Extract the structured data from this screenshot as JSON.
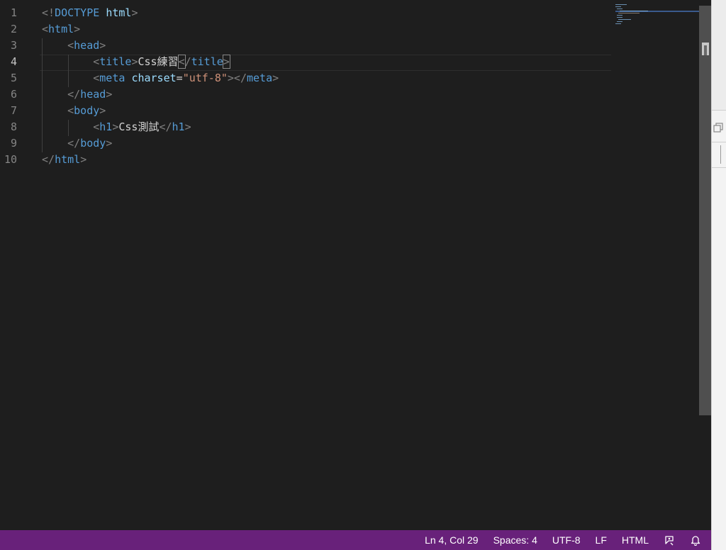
{
  "editor": {
    "lines": [
      {
        "num": "1",
        "indent": "",
        "tokens": [
          [
            "tag-brk",
            "<!"
          ],
          [
            "tag",
            "DOCTYPE"
          ],
          [
            "txt",
            " "
          ],
          [
            "attr",
            "html"
          ],
          [
            "tag-brk",
            ">"
          ]
        ]
      },
      {
        "num": "2",
        "indent": "",
        "tokens": [
          [
            "tag-brk",
            "<"
          ],
          [
            "tag",
            "html"
          ],
          [
            "tag-brk",
            ">"
          ]
        ]
      },
      {
        "num": "3",
        "indent": "    ",
        "tokens": [
          [
            "tag-brk",
            "<"
          ],
          [
            "tag",
            "head"
          ],
          [
            "tag-brk",
            ">"
          ]
        ]
      },
      {
        "num": "4",
        "indent": "        ",
        "tokens": [
          [
            "tag-brk",
            "<"
          ],
          [
            "tag",
            "title"
          ],
          [
            "tag-brk",
            ">"
          ],
          [
            "txt",
            "Css練習"
          ],
          [
            "tag-brk match",
            "<"
          ],
          [
            "tag-brk",
            "/"
          ],
          [
            "tag",
            "title"
          ],
          [
            "tag-brk match",
            ">"
          ]
        ]
      },
      {
        "num": "5",
        "indent": "        ",
        "tokens": [
          [
            "tag-brk",
            "<"
          ],
          [
            "tag",
            "meta"
          ],
          [
            "txt",
            " "
          ],
          [
            "attr",
            "charset"
          ],
          [
            "txt",
            "="
          ],
          [
            "str",
            "\"utf-8\""
          ],
          [
            "tag-brk",
            "></"
          ],
          [
            "tag",
            "meta"
          ],
          [
            "tag-brk",
            ">"
          ]
        ]
      },
      {
        "num": "6",
        "indent": "    ",
        "tokens": [
          [
            "tag-brk",
            "</"
          ],
          [
            "tag",
            "head"
          ],
          [
            "tag-brk",
            ">"
          ]
        ]
      },
      {
        "num": "7",
        "indent": "    ",
        "tokens": [
          [
            "tag-brk",
            "<"
          ],
          [
            "tag",
            "body"
          ],
          [
            "tag-brk",
            ">"
          ]
        ]
      },
      {
        "num": "8",
        "indent": "        ",
        "tokens": [
          [
            "tag-brk",
            "<"
          ],
          [
            "tag",
            "h1"
          ],
          [
            "tag-brk",
            ">"
          ],
          [
            "txt",
            "Css測試"
          ],
          [
            "tag-brk",
            "</"
          ],
          [
            "tag",
            "h1"
          ],
          [
            "tag-brk",
            ">"
          ]
        ]
      },
      {
        "num": "9",
        "indent": "    ",
        "tokens": [
          [
            "tag-brk",
            "</"
          ],
          [
            "tag",
            "body"
          ],
          [
            "tag-brk",
            ">"
          ]
        ]
      },
      {
        "num": "10",
        "indent": "",
        "tokens": [
          [
            "tag-brk",
            "</"
          ],
          [
            "tag",
            "html"
          ],
          [
            "tag-brk",
            ">"
          ]
        ]
      }
    ],
    "active_line": 4
  },
  "colors": {
    "status_bar": "#68217a",
    "editor_bg": "#1e1e1e",
    "tag": "#569cd6",
    "attribute": "#9cdcfe",
    "string": "#ce9178"
  },
  "status_bar": {
    "cursor_position": "Ln 4, Col 29",
    "indentation": "Spaces: 4",
    "encoding": "UTF-8",
    "line_ending": "LF",
    "language": "HTML",
    "feedback_icon": "feedback-icon",
    "notifications_icon": "bell-icon"
  },
  "right_panel": {
    "restore_icon": "restore-window-icon"
  }
}
